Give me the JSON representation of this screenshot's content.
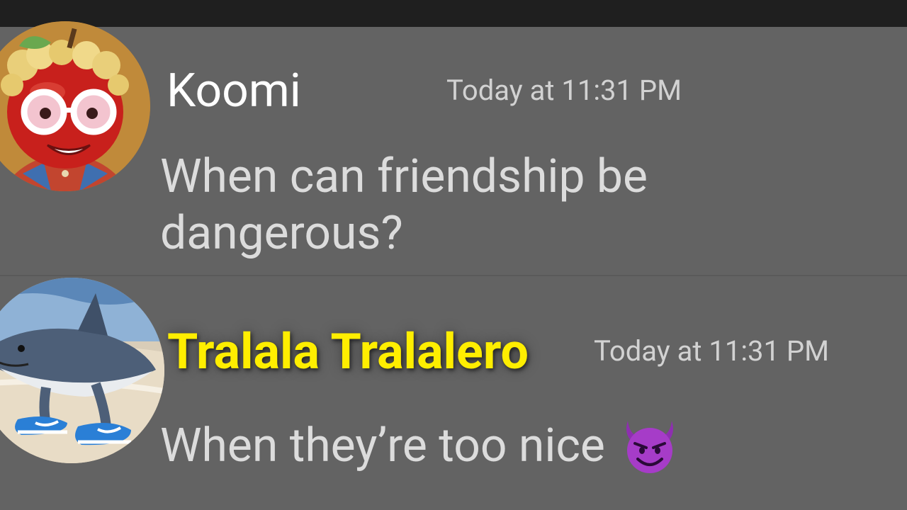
{
  "messages": [
    {
      "username": "Koomi",
      "timestamp": "Today at 11:31 PM",
      "content_line1": "When can friendship be",
      "content_line2": "dangerous?",
      "avatar_icon": "apple-character-avatar",
      "username_color": "#ffffff"
    },
    {
      "username": "Tralala Tralalero",
      "timestamp": "Today at 11:31 PM",
      "content": "When they’re too nice",
      "emoji_icon": "smiling-devil-emoji",
      "avatar_icon": "shark-in-sneakers-avatar",
      "username_color": "#ffee00"
    }
  ],
  "colors": {
    "background": "#636363",
    "top_bar": "#1f1f1f",
    "message_text": "#dcdcdc",
    "timestamp_text": "#d2d2d2"
  }
}
